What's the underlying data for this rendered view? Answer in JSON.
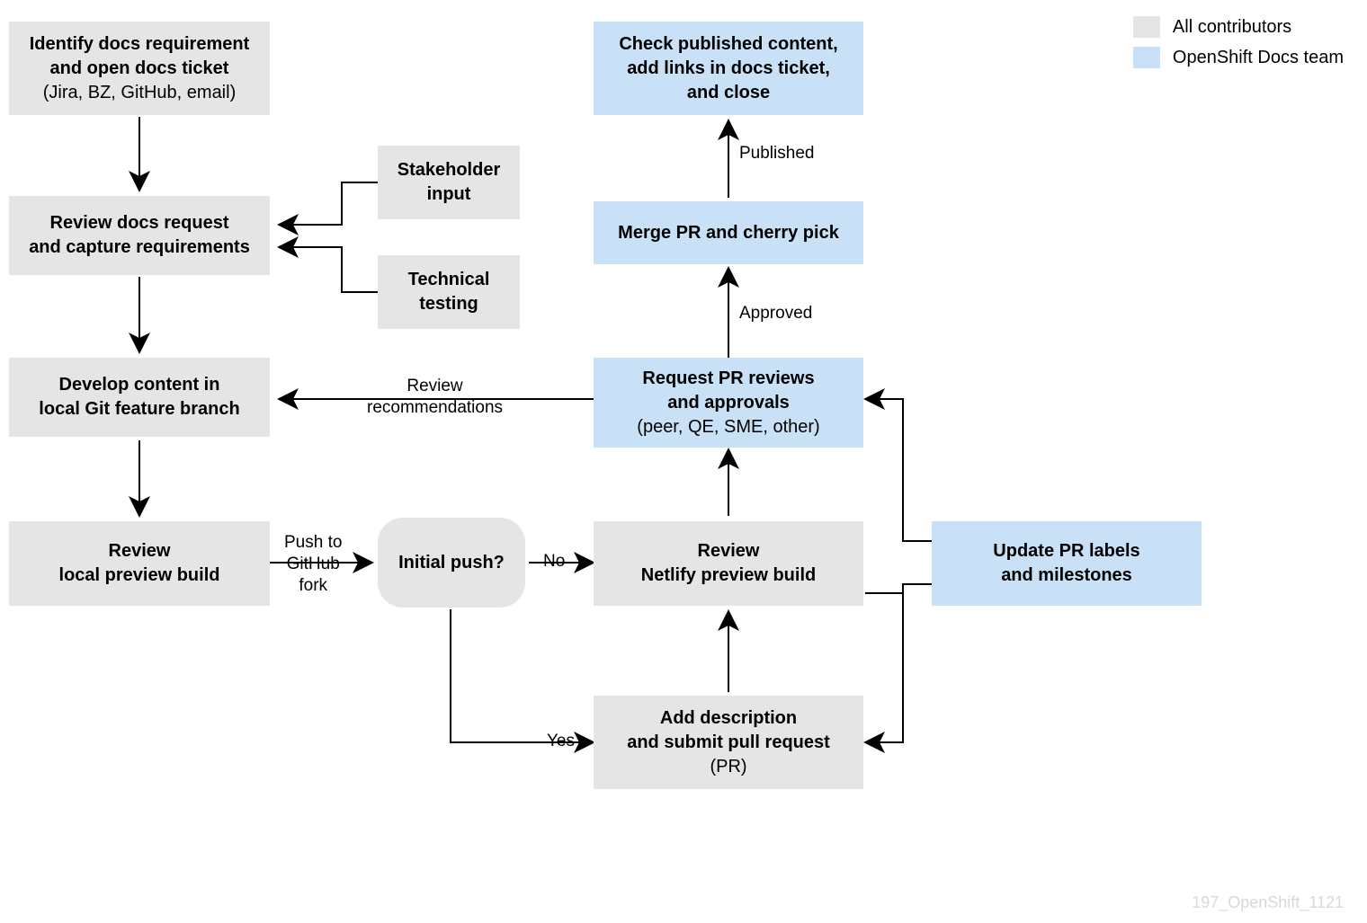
{
  "legend": {
    "all": "All contributors",
    "docs": "OpenShift Docs team"
  },
  "nodes": {
    "identify": {
      "l1": "Identify docs requirement",
      "l2": "and open docs ticket",
      "l3": "(Jira, BZ, GitHub, email)"
    },
    "review_req": {
      "l1": "Review docs request",
      "l2": "and capture requirements"
    },
    "stakeholder": {
      "l1": "Stakeholder",
      "l2": "input"
    },
    "technical": {
      "l1": "Technical",
      "l2": "testing"
    },
    "develop": {
      "l1": "Develop content in",
      "l2": "local Git feature branch"
    },
    "local": {
      "l1": "Review",
      "l2": "local preview build"
    },
    "decision": {
      "l1": "Initial push?"
    },
    "netlify": {
      "l1": "Review",
      "l2": "Netlify preview build"
    },
    "addpr": {
      "l1": "Add description",
      "l2": "and submit pull request",
      "l3": "(PR)"
    },
    "reviews": {
      "l1": "Request PR reviews",
      "l2": "and approvals",
      "l3": "(peer, QE, SME, other)"
    },
    "merge": {
      "l1": "Merge PR and cherry pick"
    },
    "check": {
      "l1": "Check published content,",
      "l2": "add links in docs ticket,",
      "l3": "and close"
    },
    "labels": {
      "l1": "Update PR labels",
      "l2": "and milestones"
    }
  },
  "edges": {
    "push": {
      "l1": "Push to",
      "l2": "GitHub",
      "l3": "fork"
    },
    "no": "No",
    "yes": "Yes",
    "recs": {
      "l1": "Review",
      "l2": "recommendations"
    },
    "approved": "Approved",
    "published": "Published"
  },
  "watermark": "197_OpenShift_1121"
}
